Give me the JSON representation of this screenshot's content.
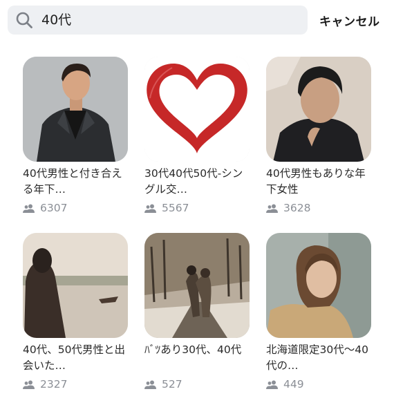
{
  "search": {
    "query": "40代",
    "cancel_label": "キャンセル"
  },
  "results": [
    {
      "title": "40代男性と付き合える年下…",
      "members": "6307",
      "image": "man-in-blazer-photo"
    },
    {
      "title": "30代40代50代-シングル交…",
      "members": "5567",
      "image": "red-heart-image"
    },
    {
      "title": "40代男性もありな年下女性",
      "members": "3628",
      "image": "man-magazine-photo"
    },
    {
      "title": "40代、50代男性と出会いた…",
      "members": "2327",
      "image": "woman-by-lake-photo"
    },
    {
      "title": "ﾊﾞﾂあり30代、40代",
      "members": "527",
      "image": "couple-walking-photo"
    },
    {
      "title": "北海道限定30代〜40代の…",
      "members": "449",
      "image": "woman-portrait-photo"
    }
  ],
  "icons": {
    "search": "search-icon",
    "members": "people-icon"
  },
  "colors": {
    "search_bg": "#eef0f3",
    "member_text": "#8b8f96",
    "heart": "#c62828"
  }
}
